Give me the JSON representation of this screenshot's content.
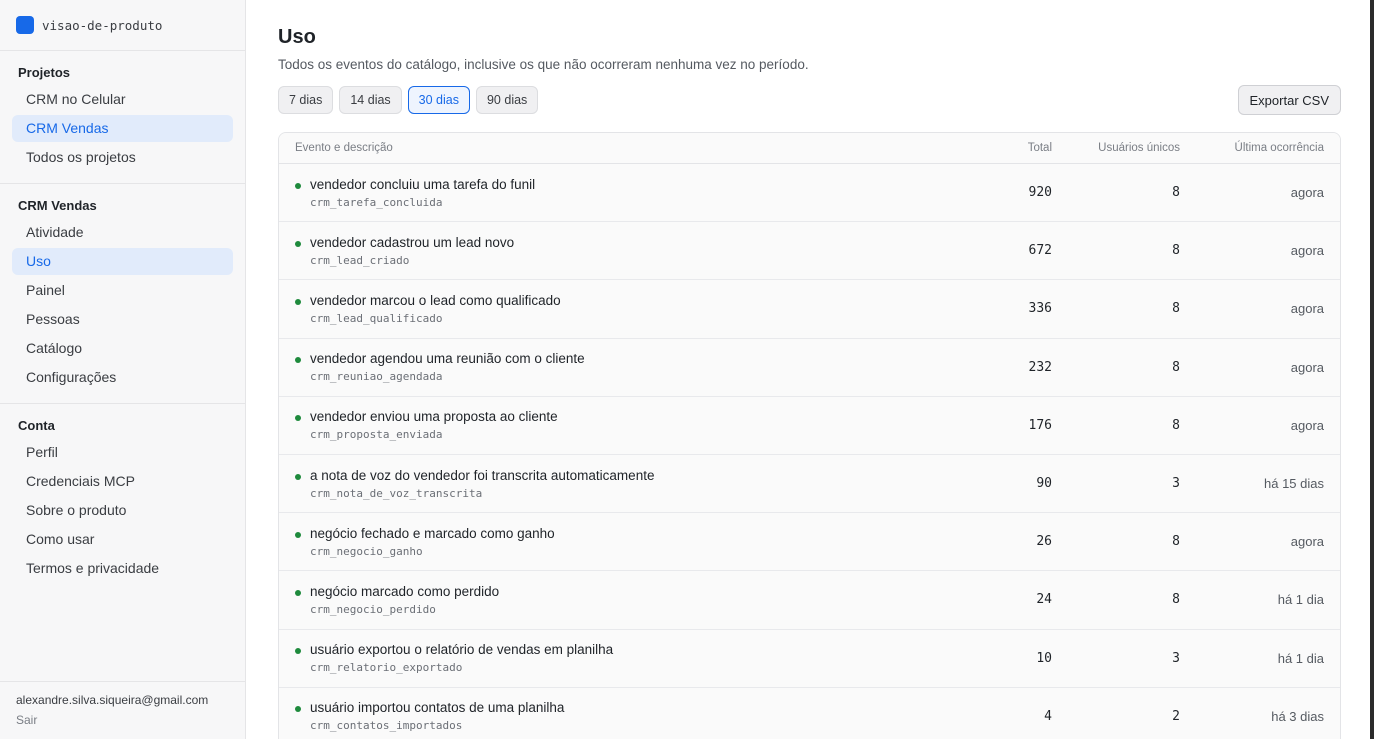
{
  "brand": {
    "name": "visao-de-produto",
    "logo_color": "#1769e8"
  },
  "sidebar": {
    "projects": {
      "title": "Projetos",
      "items": [
        {
          "label": "CRM no Celular",
          "active": false
        },
        {
          "label": "CRM Vendas",
          "active": true
        },
        {
          "label": "Todos os projetos",
          "active": false
        }
      ]
    },
    "project": {
      "title": "CRM Vendas",
      "items": [
        {
          "label": "Atividade",
          "active": false
        },
        {
          "label": "Uso",
          "active": true
        },
        {
          "label": "Painel",
          "active": false
        },
        {
          "label": "Pessoas",
          "active": false
        },
        {
          "label": "Catálogo",
          "active": false
        },
        {
          "label": "Configurações",
          "active": false
        }
      ]
    },
    "account": {
      "title": "Conta",
      "items": [
        {
          "label": "Perfil",
          "active": false
        },
        {
          "label": "Credenciais MCP",
          "active": false
        },
        {
          "label": "Sobre o produto",
          "active": false
        },
        {
          "label": "Como usar",
          "active": false
        },
        {
          "label": "Termos e privacidade",
          "active": false
        }
      ]
    },
    "footer": {
      "email": "alexandre.silva.siqueira@gmail.com",
      "logout": "Sair"
    }
  },
  "main": {
    "title": "Uso",
    "subtitle": "Todos os eventos do catálogo, inclusive os que não ocorreram nenhuma vez no período.",
    "periods": [
      {
        "label": "7 dias",
        "active": false
      },
      {
        "label": "14 dias",
        "active": false
      },
      {
        "label": "30 dias",
        "active": true
      },
      {
        "label": "90 dias",
        "active": false
      }
    ],
    "export_label": "Exportar CSV",
    "table": {
      "headers": {
        "event": "Evento e descrição",
        "total": "Total",
        "users": "Usuários únicos",
        "last": "Última ocorrência"
      },
      "rows": [
        {
          "desc": "vendedor concluiu uma tarefa do funil",
          "code": "crm_tarefa_concluida",
          "total": "920",
          "users": "8",
          "last": "agora"
        },
        {
          "desc": "vendedor cadastrou um lead novo",
          "code": "crm_lead_criado",
          "total": "672",
          "users": "8",
          "last": "agora"
        },
        {
          "desc": "vendedor marcou o lead como qualificado",
          "code": "crm_lead_qualificado",
          "total": "336",
          "users": "8",
          "last": "agora"
        },
        {
          "desc": "vendedor agendou uma reunião com o cliente",
          "code": "crm_reuniao_agendada",
          "total": "232",
          "users": "8",
          "last": "agora"
        },
        {
          "desc": "vendedor enviou uma proposta ao cliente",
          "code": "crm_proposta_enviada",
          "total": "176",
          "users": "8",
          "last": "agora"
        },
        {
          "desc": "a nota de voz do vendedor foi transcrita automaticamente",
          "code": "crm_nota_de_voz_transcrita",
          "total": "90",
          "users": "3",
          "last": "há 15 dias"
        },
        {
          "desc": "negócio fechado e marcado como ganho",
          "code": "crm_negocio_ganho",
          "total": "26",
          "users": "8",
          "last": "agora"
        },
        {
          "desc": "negócio marcado como perdido",
          "code": "crm_negocio_perdido",
          "total": "24",
          "users": "8",
          "last": "há 1 dia"
        },
        {
          "desc": "usuário exportou o relatório de vendas em planilha",
          "code": "crm_relatorio_exportado",
          "total": "10",
          "users": "3",
          "last": "há 1 dia"
        },
        {
          "desc": "usuário importou contatos de uma planilha",
          "code": "crm_contatos_importados",
          "total": "4",
          "users": "2",
          "last": "há 3 dias"
        }
      ]
    }
  },
  "colors": {
    "accent": "#1769e8",
    "status_dot": "#1e8a3c"
  }
}
